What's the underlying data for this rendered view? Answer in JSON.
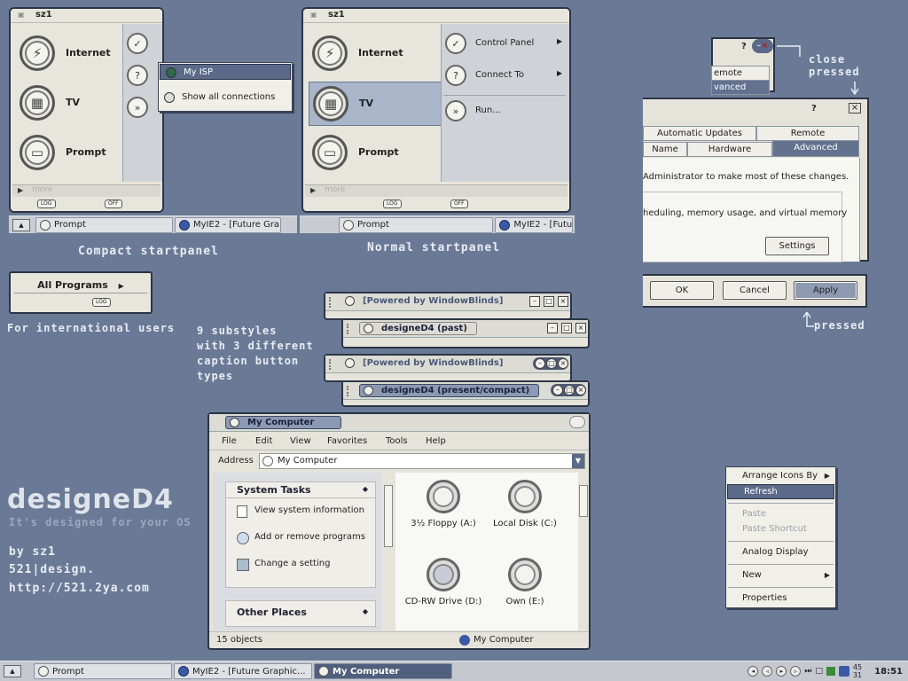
{
  "compact_panel": {
    "user": "sz1",
    "items": [
      {
        "label": "Internet",
        "icon": "lightning-icon"
      },
      {
        "label": "TV",
        "icon": "film-icon"
      },
      {
        "label": "Prompt",
        "icon": "monitor-icon"
      }
    ],
    "more": "more",
    "log_label": "LOG",
    "off_label": "OFF",
    "submenu": [
      "My ISP",
      "Show all connections"
    ],
    "caption": "Compact startpanel"
  },
  "normal_panel": {
    "user": "sz1",
    "items": [
      {
        "label": "Internet",
        "icon": "lightning-icon"
      },
      {
        "label": "TV",
        "icon": "film-icon"
      },
      {
        "label": "Prompt",
        "icon": "monitor-icon"
      }
    ],
    "side": [
      "Control Panel",
      "Connect To",
      "Run..."
    ],
    "more": "more",
    "log_label": "LOG",
    "off_label": "OFF",
    "caption": "Normal startpanel"
  },
  "mini_taskbars": {
    "prompt": "Prompt",
    "myie": "MyIE2 - [Future Gra",
    "myie2": "MyIE2 - [Future"
  },
  "intl": {
    "all_programs": "All Programs",
    "log_label": "LOG",
    "caption": "For international users"
  },
  "substyles_caption": [
    "9 substyles",
    "with 3 different",
    "caption button",
    "types"
  ],
  "sample_windows": [
    "[Powered by WindowBlinds]",
    "designeD4 (past)",
    "[Powered by WindowBlinds]",
    "designeD4 (present/compact)"
  ],
  "dialog": {
    "help": "?",
    "close": "×",
    "top_tabs": [
      "Automatic Updates",
      "Remote"
    ],
    "bottom_tabs": [
      "Name",
      "Hardware",
      "Advanced"
    ],
    "partial_tab_1": "emote",
    "partial_tab_2": "vanced",
    "text1": "Administrator to make most of these changes.",
    "text2": "heduling, memory usage, and virtual memory",
    "settings": "Settings",
    "ok": "OK",
    "cancel": "Cancel",
    "apply": "Apply",
    "close_caption": [
      "close",
      "pressed"
    ],
    "pressed_caption": "pressed"
  },
  "branding": {
    "name": "designeD4",
    "tagline": "It's designed for your OS",
    "by": "by sz1",
    "studio": "521|design.",
    "url": "http://521.2ya.com"
  },
  "explorer": {
    "title": "My Computer",
    "menu": [
      "File",
      "Edit",
      "View",
      "Favorites",
      "Tools",
      "Help"
    ],
    "address_label": "Address",
    "address_value": "My Computer",
    "system_tasks": "System Tasks",
    "tasks": [
      "View system information",
      "Add or remove programs",
      "Change a setting"
    ],
    "other_places": "Other Places",
    "drives": [
      "3½ Floppy (A:)",
      "Local Disk (C:)",
      "CD-RW Drive (D:)",
      "Own (E:)"
    ],
    "status_left": "15 objects",
    "status_right": "My Computer"
  },
  "context_menu": {
    "items": [
      "Arrange Icons By",
      "Refresh",
      "Paste",
      "Paste Shortcut",
      "Analog Display",
      "New",
      "Properties"
    ]
  },
  "taskbar": {
    "buttons": [
      "Prompt",
      "MyIE2 - [Future Graphic...",
      "My Computer"
    ],
    "time": "18:51",
    "cpu_top": "45",
    "cpu_bottom": "31"
  }
}
